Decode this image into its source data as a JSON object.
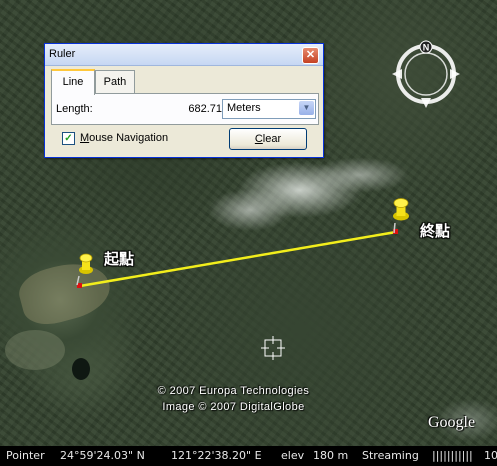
{
  "map": {
    "start_label": "起點",
    "end_label": "終點",
    "compass_north": "N",
    "copyright_line1": "© 2007 Europa Technologies",
    "copyright_line2": "Image © 2007 DigitalGlobe",
    "logo": "Google",
    "line_color": "#f2ee1c"
  },
  "ruler": {
    "title": "Ruler",
    "tabs": [
      "Line",
      "Path"
    ],
    "active_tab": "Line",
    "length_label": "Length:",
    "length_value": "682.71",
    "units": "Meters",
    "mouse_nav_checked": true,
    "mouse_nav_label": "Mouse Navigation",
    "mouse_nav_mnemonic": "M",
    "mouse_nav_rest": "ouse Navigation",
    "clear_label": "Clear",
    "clear_mnemonic": "C",
    "clear_rest": "lear"
  },
  "status_bar": {
    "pointer_label": "Pointer",
    "latitude": "24°59'24.03\" N",
    "longitude": "121°22'38.20\" E",
    "elev_label": "elev",
    "elevation": "180 m",
    "streaming_label": "Streaming",
    "streaming_bar": "|||||||||||",
    "streaming_percent": "10"
  },
  "icons": {
    "compass": "compass-icon",
    "pin": "pushpin-icon",
    "crosshair": "crosshair-icon",
    "close": "close-icon",
    "dropdown": "chevron-down-icon",
    "check": "checkmark-icon"
  }
}
